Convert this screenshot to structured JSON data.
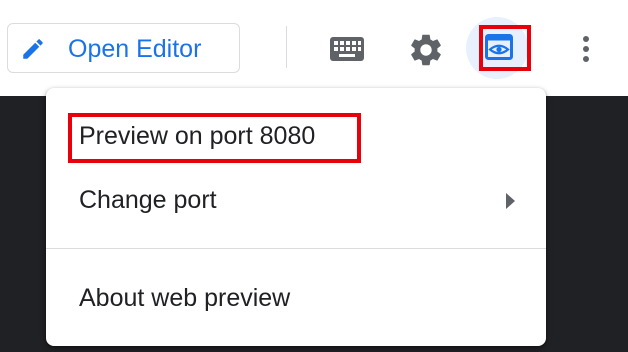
{
  "toolbar": {
    "open_editor_label": "Open Editor",
    "icons": {
      "edit": "pencil-icon",
      "keyboard": "keyboard-icon",
      "settings": "gear-icon",
      "web_preview": "web-preview-icon",
      "more": "more-vert-icon"
    }
  },
  "menu": {
    "items": [
      {
        "label": "Preview on port 8080"
      },
      {
        "label": "Change port",
        "has_submenu": true
      },
      {
        "label": "About web preview"
      }
    ]
  },
  "colors": {
    "accent": "#1a73e8",
    "highlight": "#e8000b",
    "active_button_bg": "#e8f0fe",
    "menu_text": "#202124",
    "icon": "#5f6368",
    "backdrop": "#202124"
  }
}
